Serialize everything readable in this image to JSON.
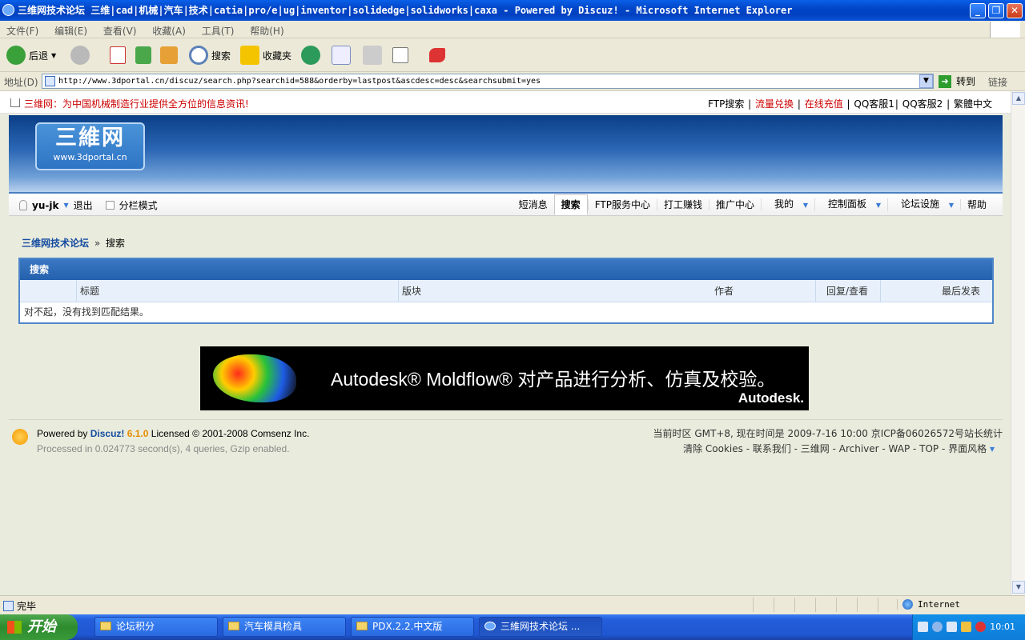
{
  "window": {
    "title": "三维网技术论坛 三维|cad|机械|汽车|技术|catia|pro/e|ug|inventor|solidedge|solidworks|caxa - Powered by Discuz! - Microsoft Internet Explorer",
    "minimize": "_",
    "restore": "❐",
    "close": "✕"
  },
  "menu": [
    "文件(F)",
    "编辑(E)",
    "查看(V)",
    "收藏(A)",
    "工具(T)",
    "帮助(H)"
  ],
  "toolbar": {
    "back": "后退",
    "search": "搜索",
    "favorites": "收藏夹"
  },
  "address": {
    "label": "地址(D)",
    "url": "http://www.3dportal.cn/discuz/search.php?searchid=588&orderby=lastpost&ascdesc=desc&searchsubmit=yes",
    "go": "转到",
    "links": "链接"
  },
  "site": {
    "slogan": "三维网：为中国机械制造行业提供全方位的信息资讯!",
    "top_links": [
      "FTP搜索",
      "流量兑换",
      "在线充值",
      "QQ客服1",
      "QQ客服2",
      "繁體中文"
    ],
    "logo_main": "三維网",
    "logo_url": "www.3dportal.cn"
  },
  "nav": {
    "username": "yu-jk",
    "logout": "退出",
    "split_mode": "分栏模式",
    "items": [
      "短消息",
      "搜索",
      "FTP服务中心",
      "打工赚钱",
      "推广中心",
      "我的",
      "控制面板",
      "论坛设施",
      "帮助"
    ]
  },
  "breadcrumb": {
    "site": "三维网技术论坛",
    "sep": "»",
    "current": "搜索"
  },
  "search": {
    "header": "搜索",
    "columns": [
      "标题",
      "版块",
      "作者",
      "回复/查看",
      "最后发表"
    ],
    "no_result": "对不起，没有找到匹配结果。"
  },
  "ad": {
    "text": "Autodesk® Moldflow® 对产品进行分析、仿真及校验。",
    "brand": "Autodesk."
  },
  "footer": {
    "powered_by": "Powered by",
    "discuz": "Discuz!",
    "version": "6.1.0",
    "license": "Licensed © 2001-2008 Comsenz Inc.",
    "processed": "Processed in 0.024773 second(s), 4 queries, Gzip enabled.",
    "time_info": "当前时区  GMT+8, 现在时间是  2009-7-16 10:00 京ICP备06026572号站长统计",
    "links": "清除 Cookies - 联系我们 - 三维网 - Archiver - WAP - TOP - 界面风格",
    "drop": "▾"
  },
  "status": {
    "text": "完毕",
    "zone": "Internet"
  },
  "taskbar": {
    "start": "开始",
    "tasks": [
      "论坛积分",
      "汽车模具检具",
      "PDX.2.2.中文版",
      "三維网技术论坛 ..."
    ],
    "clock": "10:01"
  }
}
